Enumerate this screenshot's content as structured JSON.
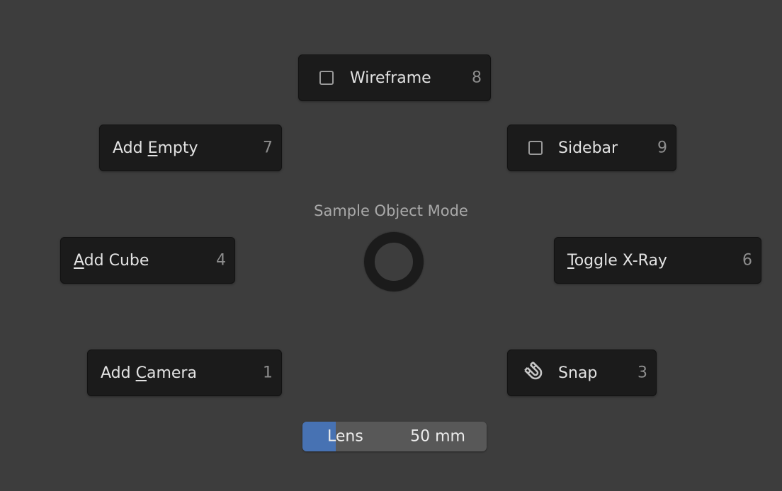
{
  "pie_menu": {
    "title": "Sample Object Mode",
    "items": {
      "wireframe": {
        "label": "Wireframe",
        "shortcut": "8",
        "icon": "checkbox-icon",
        "checked": false
      },
      "add_empty": {
        "label_pre": "Add ",
        "label_ul": "E",
        "label_post": "mpty",
        "shortcut": "7"
      },
      "sidebar": {
        "label": "Sidebar",
        "shortcut": "9",
        "icon": "checkbox-icon",
        "checked": false
      },
      "add_cube": {
        "label_pre": "",
        "label_ul": "A",
        "label_post": "dd Cube",
        "shortcut": "4"
      },
      "toggle_xray": {
        "label_pre": "",
        "label_ul": "T",
        "label_post": "oggle X-Ray",
        "shortcut": "6"
      },
      "add_camera": {
        "label_pre": "Add ",
        "label_ul": "C",
        "label_post": "amera",
        "shortcut": "1"
      },
      "snap": {
        "label": "Snap",
        "shortcut": "3",
        "icon": "magnet-icon"
      }
    },
    "lens": {
      "label": "Lens",
      "value": "50 mm",
      "fill_fraction": 0.18,
      "fill_color": "#4772b3"
    }
  }
}
